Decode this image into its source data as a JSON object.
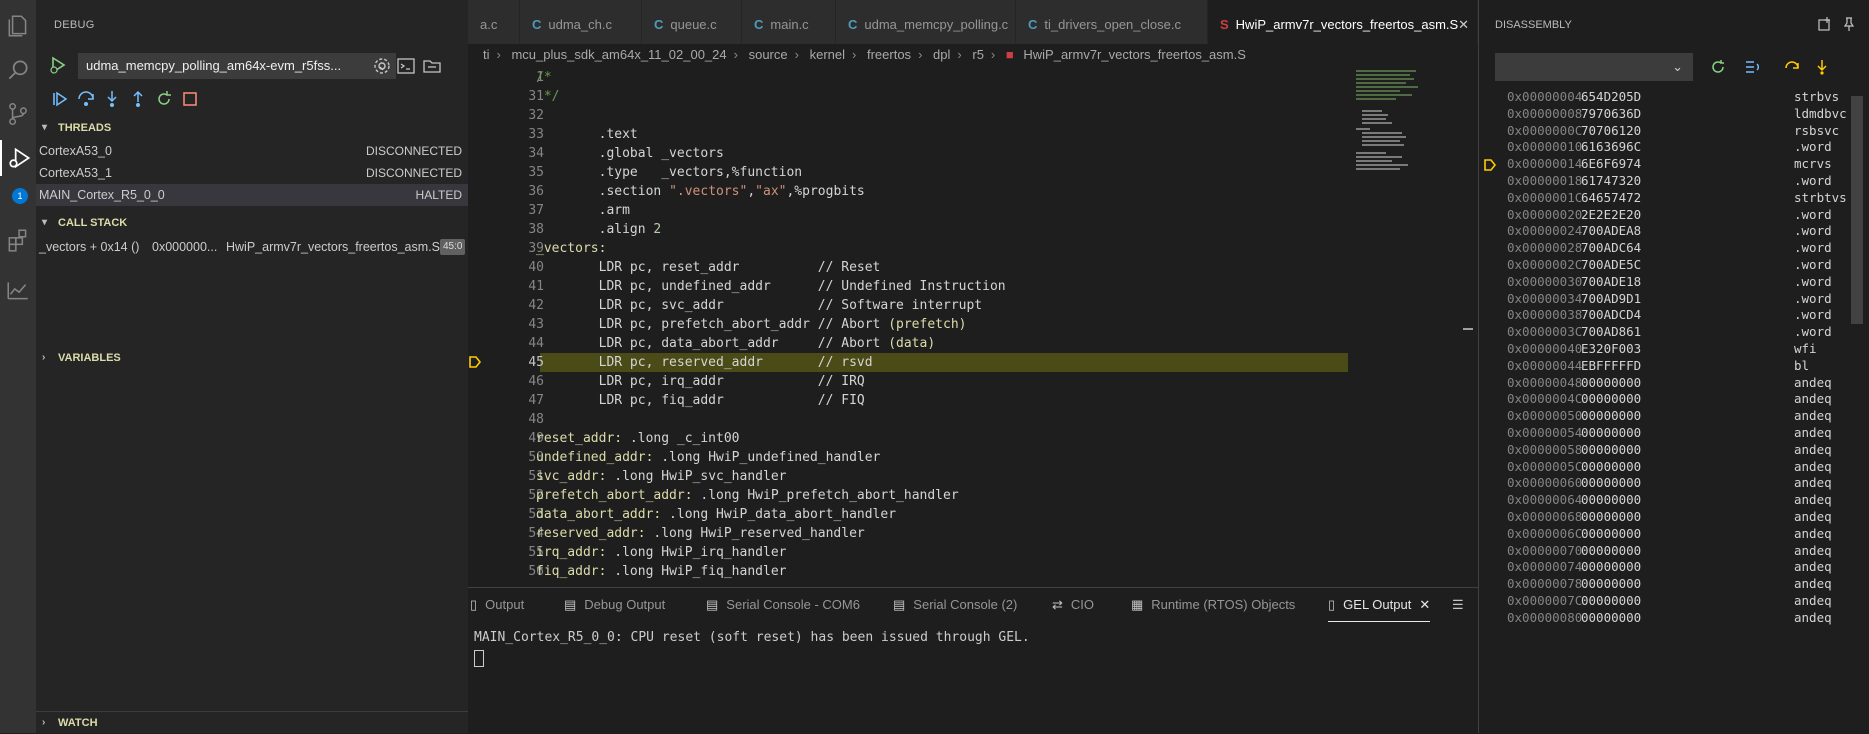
{
  "sidebar": {
    "title": "DEBUG",
    "config_name": "udma_memcpy_polling_am64x-evm_r5fss...",
    "sections": {
      "threads": "THREADS",
      "call_stack": "CALL STACK",
      "variables": "VARIABLES",
      "watch": "WATCH"
    },
    "threads": [
      {
        "name": "CortexA53_0",
        "state": "DISCONNECTED"
      },
      {
        "name": "CortexA53_1",
        "state": "DISCONNECTED"
      },
      {
        "name": "MAIN_Cortex_R5_0_0",
        "state": "HALTED"
      }
    ],
    "stack_frame": {
      "func": "_vectors + 0x14 ()",
      "addr": "0x000000...",
      "file": "HwiP_armv7r_vectors_freertos_asm.S",
      "line": "45:0"
    }
  },
  "activity": {
    "debug_badge": "1"
  },
  "tabs": [
    {
      "label": "a.c",
      "icon": "C"
    },
    {
      "label": "udma_ch.c",
      "icon": "C"
    },
    {
      "label": "queue.c",
      "icon": "C"
    },
    {
      "label": "main.c",
      "icon": "C"
    },
    {
      "label": "udma_memcpy_polling.c",
      "icon": "C"
    },
    {
      "label": "ti_drivers_open_close.c",
      "icon": "C"
    },
    {
      "label": "HwiP_armv7r_vectors_freertos_asm.S",
      "icon": "S"
    }
  ],
  "breadcrumb": [
    "ti",
    "mcu_plus_sdk_am64x_11_02_00_24",
    "source",
    "kernel",
    "freertos",
    "dpl",
    "r5",
    "HwiP_armv7r_vectors_freertos_asm.S"
  ],
  "code": [
    {
      "n": "1",
      "html": "<span class='cm'>/*</span>"
    },
    {
      "n": "31",
      "html": "<span class='cm'> */</span>"
    },
    {
      "n": "32",
      "html": ""
    },
    {
      "n": "33",
      "html": "        .text"
    },
    {
      "n": "34",
      "html": "        .global _vectors"
    },
    {
      "n": "35",
      "html": "        .type   _vectors,%function"
    },
    {
      "n": "36",
      "html": "        .section <span class='str'>\".vectors\"</span>,<span class='str'>\"ax\"</span>,%progbits"
    },
    {
      "n": "37",
      "html": "        .arm"
    },
    {
      "n": "38",
      "html": "        .align <span class='num'>2</span>"
    },
    {
      "n": "39",
      "html": "<span class='lbl'>_vectors:</span>"
    },
    {
      "n": "40",
      "html": "        LDR pc, reset_addr          // Reset"
    },
    {
      "n": "41",
      "html": "        LDR pc, undefined_addr      // Undefined Instruction"
    },
    {
      "n": "42",
      "html": "        LDR pc, svc_addr            // Software interrupt"
    },
    {
      "n": "43",
      "html": "        LDR pc, prefetch_abort_addr // Abort <span class='lbl'>(prefetch)</span>"
    },
    {
      "n": "44",
      "html": "        LDR pc, data_abort_addr     // Abort <span class='lbl'>(data)</span>"
    },
    {
      "n": "45",
      "html": "        LDR pc, reserved_addr       // rsvd",
      "current": true
    },
    {
      "n": "46",
      "html": "        LDR pc, irq_addr            // IRQ"
    },
    {
      "n": "47",
      "html": "        LDR pc, fiq_addr            // FIQ"
    },
    {
      "n": "48",
      "html": ""
    },
    {
      "n": "49",
      "html": "<span class='lbl'>reset_addr:</span> .long _c_int00"
    },
    {
      "n": "50",
      "html": "<span class='lbl'>undefined_addr:</span> .long HwiP_undefined_handler"
    },
    {
      "n": "51",
      "html": "<span class='lbl'>svc_addr:</span> .long HwiP_svc_handler"
    },
    {
      "n": "52",
      "html": "<span class='lbl'>prefetch_abort_addr:</span> .long HwiP_prefetch_abort_handler"
    },
    {
      "n": "53",
      "html": "<span class='lbl'>data_abort_addr:</span> .long HwiP_data_abort_handler"
    },
    {
      "n": "54",
      "html": "<span class='lbl'>reserved_addr:</span> .long HwiP_reserved_handler"
    },
    {
      "n": "55",
      "html": "<span class='lbl'>irq_addr:</span> .long HwiP_irq_handler"
    },
    {
      "n": "56",
      "html": "<span class='lbl'>fiq_addr:</span> .long HwiP_fiq_handler"
    }
  ],
  "panel": {
    "tabs": [
      {
        "label": "Output",
        "icon": "▯"
      },
      {
        "label": "Debug Output",
        "icon": "▤"
      },
      {
        "label": "Serial Console - COM6",
        "icon": "▤"
      },
      {
        "label": "Serial Console (2)",
        "icon": "▤"
      },
      {
        "label": "CIO",
        "icon": "⇄"
      },
      {
        "label": "Runtime (RTOS) Objects",
        "icon": "▦"
      },
      {
        "label": "GEL Output",
        "icon": "▯"
      }
    ],
    "text": "MAIN_Cortex_R5_0_0: CPU reset (soft reset) has been issued through GEL."
  },
  "disassembly": {
    "title": "DISASSEMBLY",
    "rows": [
      {
        "addr": "0x00000004",
        "op": "654D205D",
        "ins": "strbvs"
      },
      {
        "addr": "0x00000008",
        "op": "7970636D",
        "ins": "ldmdbvc"
      },
      {
        "addr": "0x0000000C",
        "op": "70706120",
        "ins": "rsbsvc"
      },
      {
        "addr": "0x00000010",
        "op": "6163696C",
        "ins": ".word"
      },
      {
        "addr": "0x00000014",
        "op": "6E6F6974",
        "ins": "mcrvs",
        "pc": true
      },
      {
        "addr": "0x00000018",
        "op": "61747320",
        "ins": ".word"
      },
      {
        "addr": "0x0000001C",
        "op": "64657472",
        "ins": "strbtvs"
      },
      {
        "addr": "0x00000020",
        "op": "2E2E2E20",
        "ins": ".word"
      },
      {
        "addr": "0x00000024",
        "op": "700ADEA8",
        "ins": ".word"
      },
      {
        "addr": "0x00000028",
        "op": "700ADC64",
        "ins": ".word"
      },
      {
        "addr": "0x0000002C",
        "op": "700ADE5C",
        "ins": ".word"
      },
      {
        "addr": "0x00000030",
        "op": "700ADE18",
        "ins": ".word"
      },
      {
        "addr": "0x00000034",
        "op": "700AD9D1",
        "ins": ".word"
      },
      {
        "addr": "0x00000038",
        "op": "700ADCD4",
        "ins": ".word"
      },
      {
        "addr": "0x0000003C",
        "op": "700AD861",
        "ins": ".word"
      },
      {
        "addr": "0x00000040",
        "op": "E320F003",
        "ins": "wfi"
      },
      {
        "addr": "0x00000044",
        "op": "EBFFFFFD",
        "ins": "bl"
      },
      {
        "addr": "0x00000048",
        "op": "00000000",
        "ins": "andeq"
      },
      {
        "addr": "0x0000004C",
        "op": "00000000",
        "ins": "andeq"
      },
      {
        "addr": "0x00000050",
        "op": "00000000",
        "ins": "andeq"
      },
      {
        "addr": "0x00000054",
        "op": "00000000",
        "ins": "andeq"
      },
      {
        "addr": "0x00000058",
        "op": "00000000",
        "ins": "andeq"
      },
      {
        "addr": "0x0000005C",
        "op": "00000000",
        "ins": "andeq"
      },
      {
        "addr": "0x00000060",
        "op": "00000000",
        "ins": "andeq"
      },
      {
        "addr": "0x00000064",
        "op": "00000000",
        "ins": "andeq"
      },
      {
        "addr": "0x00000068",
        "op": "00000000",
        "ins": "andeq"
      },
      {
        "addr": "0x0000006C",
        "op": "00000000",
        "ins": "andeq"
      },
      {
        "addr": "0x00000070",
        "op": "00000000",
        "ins": "andeq"
      },
      {
        "addr": "0x00000074",
        "op": "00000000",
        "ins": "andeq"
      },
      {
        "addr": "0x00000078",
        "op": "00000000",
        "ins": "andeq"
      },
      {
        "addr": "0x0000007C",
        "op": "00000000",
        "ins": "andeq"
      },
      {
        "addr": "0x00000080",
        "op": "00000000",
        "ins": "andeq"
      }
    ]
  },
  "colors": {
    "accent": "#0078d4",
    "current_line": "#4b4b18",
    "pc_marker": "#ffcc00",
    "continue": "#75beff",
    "restart": "#89d185",
    "stop": "#f48771"
  }
}
